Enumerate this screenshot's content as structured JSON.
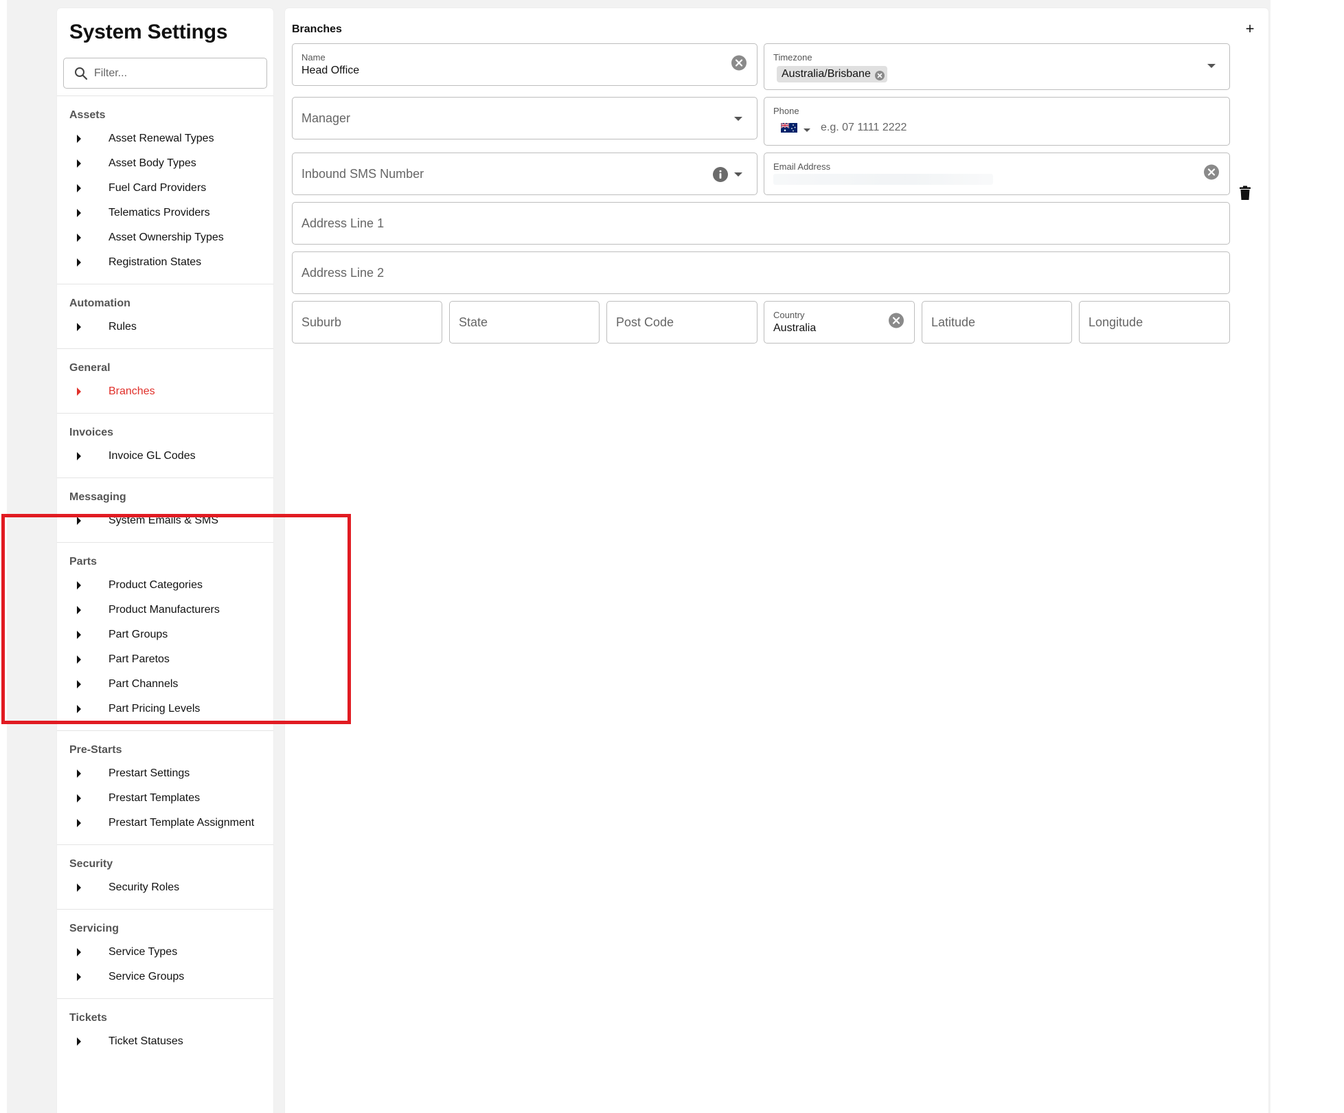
{
  "sidebar": {
    "title": "System Settings",
    "filter_placeholder": "Filter...",
    "sections": [
      {
        "title": "Assets",
        "items": [
          "Asset Renewal Types",
          "Asset Body Types",
          "Fuel Card Providers",
          "Telematics Providers",
          "Asset Ownership Types",
          "Registration States"
        ]
      },
      {
        "title": "Automation",
        "items": [
          "Rules"
        ]
      },
      {
        "title": "General",
        "items": [
          "Branches"
        ],
        "active_item": "Branches"
      },
      {
        "title": "Invoices",
        "items": [
          "Invoice GL Codes"
        ]
      },
      {
        "title": "Messaging",
        "items": [
          "System Emails & SMS"
        ]
      },
      {
        "title": "Parts",
        "items": [
          "Product Categories",
          "Product Manufacturers",
          "Part Groups",
          "Part Paretos",
          "Part Channels",
          "Part Pricing Levels"
        ]
      },
      {
        "title": "Pre-Starts",
        "items": [
          "Prestart Settings",
          "Prestart Templates",
          "Prestart Template Assignment"
        ]
      },
      {
        "title": "Security",
        "items": [
          "Security Roles"
        ]
      },
      {
        "title": "Servicing",
        "items": [
          "Service Types",
          "Service Groups"
        ]
      },
      {
        "title": "Tickets",
        "items": [
          "Ticket Statuses"
        ]
      }
    ]
  },
  "main": {
    "title": "Branches",
    "add_label": "+",
    "form": {
      "name": {
        "label": "Name",
        "value": "Head Office"
      },
      "timezone": {
        "label": "Timezone",
        "value": "Australia/Brisbane"
      },
      "manager": {
        "placeholder": "Manager"
      },
      "phone": {
        "label": "Phone",
        "placeholder": "e.g. 07 1111 2222",
        "country_flag": "australia-flag-icon"
      },
      "inbound_sms": {
        "placeholder": "Inbound SMS Number"
      },
      "email": {
        "label": "Email Address"
      },
      "address1": {
        "placeholder": "Address Line 1"
      },
      "address2": {
        "placeholder": "Address Line 2"
      },
      "suburb": {
        "placeholder": "Suburb"
      },
      "state": {
        "placeholder": "State"
      },
      "postcode": {
        "placeholder": "Post Code"
      },
      "country": {
        "label": "Country",
        "value": "Australia"
      },
      "latitude": {
        "placeholder": "Latitude"
      },
      "longitude": {
        "placeholder": "Longitude"
      }
    }
  },
  "colors": {
    "accent": "#e0302a",
    "highlight": "#e11b22",
    "background": "#f2f2f2"
  }
}
